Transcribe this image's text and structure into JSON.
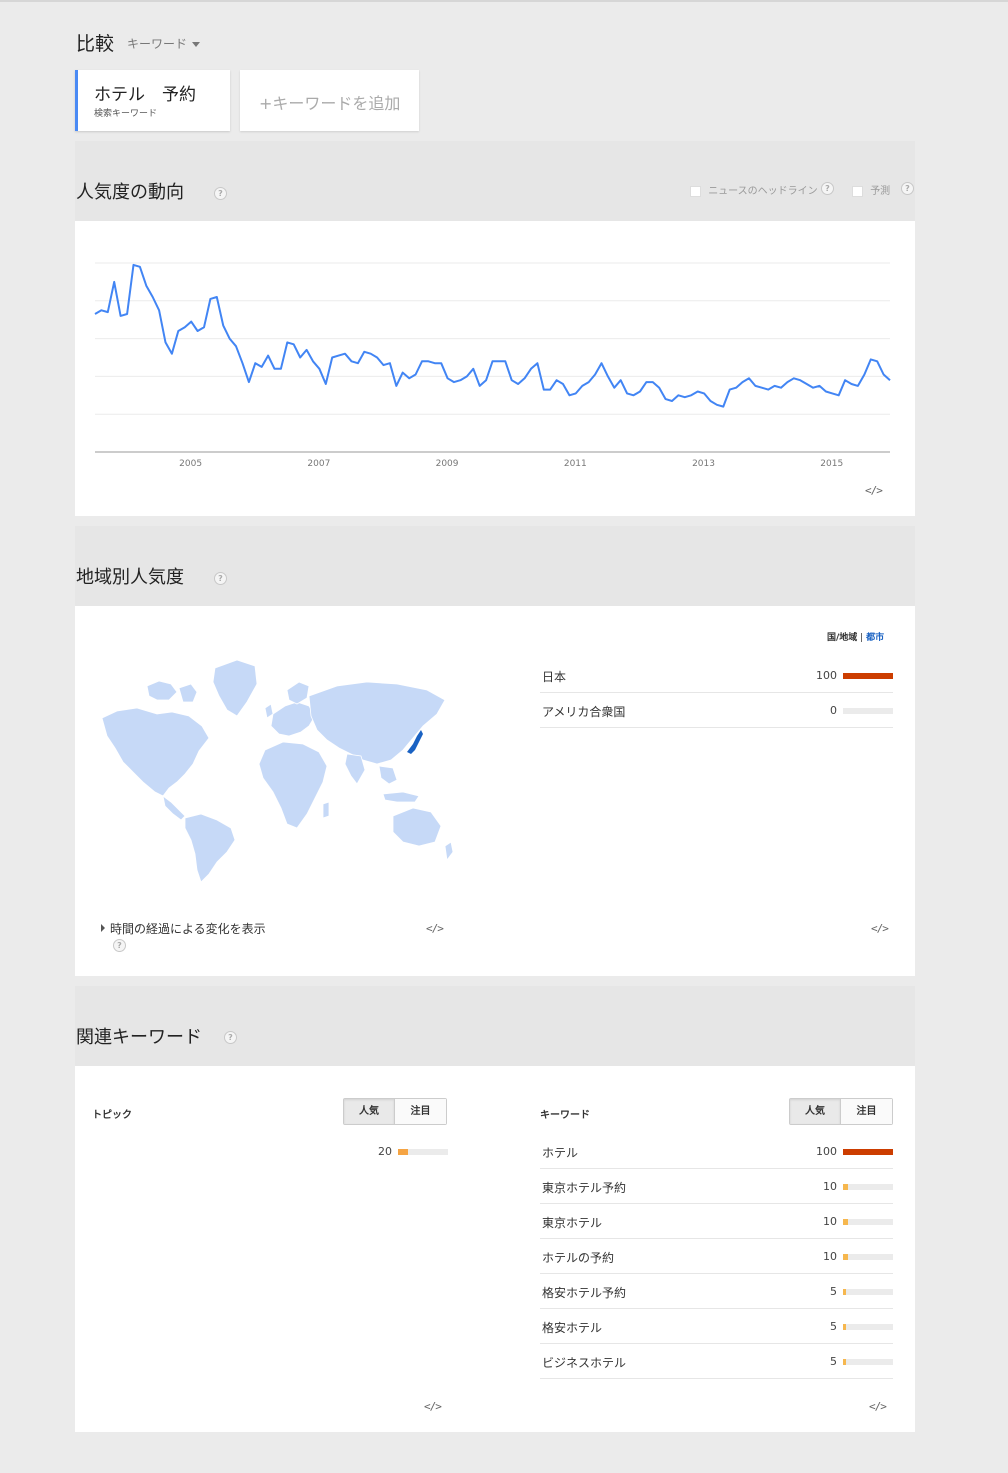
{
  "header": {
    "compare_label": "比較",
    "compare_type": "キーワード",
    "term": {
      "name": "ホテル　予約",
      "sub": "検索キーワード"
    },
    "add_term": "+キーワードを追加"
  },
  "interest": {
    "title": "人気度の動向",
    "help": "?",
    "option_news": "ニュースのヘッドライン",
    "option_forecast": "予測",
    "embed": "</>"
  },
  "chart_data": {
    "type": "line",
    "title": "",
    "xlabel": "",
    "ylabel": "",
    "x_tick_labels": [
      "2005",
      "2007",
      "2009",
      "2011",
      "2013",
      "2015"
    ],
    "x_range": [
      2004.0,
      2016.4
    ],
    "ylim": [
      0,
      100
    ],
    "grid": true,
    "color": "#4285f4",
    "series": [
      {
        "x": [
          2004.0,
          2004.1,
          2004.2,
          2004.3,
          2004.4,
          2004.5,
          2004.6,
          2004.7,
          2004.8,
          2004.9,
          2005.0,
          2005.1,
          2005.2,
          2005.3,
          2005.4,
          2005.5,
          2005.6,
          2005.7,
          2005.8,
          2005.9,
          2006.0,
          2006.1,
          2006.2,
          2006.3,
          2006.4,
          2006.5,
          2006.6,
          2006.7,
          2006.8,
          2006.9,
          2007.0,
          2007.1,
          2007.2,
          2007.3,
          2007.4,
          2007.5,
          2007.6,
          2007.7,
          2007.8,
          2007.9,
          2008.0,
          2008.1,
          2008.2,
          2008.3,
          2008.4,
          2008.5,
          2008.6,
          2008.7,
          2008.8,
          2008.9,
          2009.0,
          2009.1,
          2009.2,
          2009.3,
          2009.4,
          2009.5,
          2009.6,
          2009.7,
          2009.8,
          2009.9,
          2010.0,
          2010.1,
          2010.2,
          2010.3,
          2010.4,
          2010.5,
          2010.6,
          2010.7,
          2010.8,
          2010.9,
          2011.0,
          2011.1,
          2011.2,
          2011.3,
          2011.4,
          2011.5,
          2011.6,
          2011.7,
          2011.8,
          2011.9,
          2012.0,
          2012.1,
          2012.2,
          2012.3,
          2012.4,
          2012.5,
          2012.6,
          2012.7,
          2012.8,
          2012.9,
          2013.0,
          2013.1,
          2013.2,
          2013.3,
          2013.4,
          2013.5,
          2013.6,
          2013.7,
          2013.8,
          2013.9,
          2014.0,
          2014.1,
          2014.2,
          2014.3,
          2014.4,
          2014.5,
          2014.6,
          2014.7,
          2014.8,
          2014.9,
          2015.0,
          2015.1,
          2015.2,
          2015.3,
          2015.4,
          2015.5,
          2015.6,
          2015.7,
          2015.8,
          2015.9,
          2016.0,
          2016.1,
          2016.2,
          2016.3,
          2016.4
        ],
        "values": [
          73,
          75,
          74,
          90,
          72,
          73,
          99,
          98,
          88,
          82,
          75,
          58,
          52,
          64,
          66,
          69,
          64,
          66,
          81,
          82,
          67,
          60,
          56,
          47,
          37,
          47,
          45,
          51,
          44,
          44,
          58,
          57,
          50,
          54,
          48,
          44,
          36,
          50,
          51,
          52,
          48,
          47,
          53,
          52,
          50,
          46,
          47,
          35,
          42,
          39,
          41,
          48,
          48,
          47,
          47,
          39,
          37,
          38,
          40,
          44,
          35,
          38,
          48,
          48,
          48,
          38,
          36,
          39,
          44,
          47,
          33,
          33,
          38,
          36,
          30,
          31,
          35,
          37,
          41,
          47,
          40,
          34,
          38,
          31,
          30,
          32,
          37,
          37,
          34,
          28,
          27,
          30,
          29,
          30,
          32,
          31,
          27,
          25,
          24,
          33,
          34,
          37,
          39,
          35,
          34,
          33,
          35,
          34,
          37,
          39,
          38,
          36,
          34,
          35,
          32,
          31,
          30,
          38,
          36,
          35,
          41,
          49,
          48,
          41,
          38
        ]
      }
    ]
  },
  "region": {
    "title": "地域別人気度",
    "help": "?",
    "mode_country": "国/地域",
    "mode_sep": "|",
    "mode_city": "都市",
    "time_change": "時間の経過による変化を表示",
    "rows": [
      {
        "name": "日本",
        "value": 100
      },
      {
        "name": "アメリカ合衆国",
        "value": 0
      }
    ]
  },
  "related": {
    "title": "関連キーワード",
    "help": "?",
    "topics": {
      "label": "トピック",
      "tab_top": "人気",
      "tab_rising": "注目",
      "rows": [
        {
          "name": "",
          "value": 20
        }
      ]
    },
    "queries": {
      "label": "キーワード",
      "tab_top": "人気",
      "tab_rising": "注目",
      "rows": [
        {
          "name": "ホテル",
          "value": 100
        },
        {
          "name": "東京ホテル予約",
          "value": 10
        },
        {
          "name": "東京ホテル",
          "value": 10
        },
        {
          "name": "ホテルの予約",
          "value": 10
        },
        {
          "name": "格安ホテル予約",
          "value": 5
        },
        {
          "name": "格安ホテル",
          "value": 5
        },
        {
          "name": "ビジネスホテル",
          "value": 5
        }
      ]
    }
  },
  "colors": {
    "accent": "#4a8af4",
    "bar_full": "#cc3d00",
    "bar_small": "#f6b74e",
    "bar_topic": "#f5a443",
    "map_land": "#c6d9f7",
    "map_japan": "#1a62c3"
  }
}
